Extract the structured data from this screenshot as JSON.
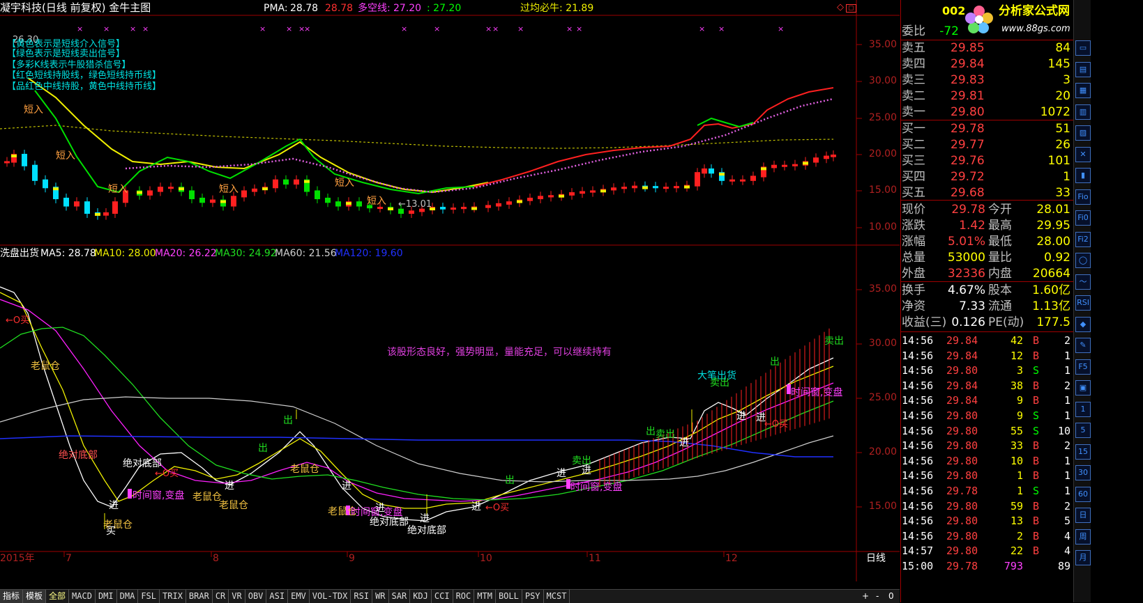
{
  "header": {
    "title": "凝宇科技(日线 前复权) 金牛主图",
    "pma_label": "PMA:",
    "pma_value1": "28.78",
    "pma_value2": "28.78",
    "dkx_label": "多空线:",
    "dkx_value1": "27.20",
    "dkx_value2": ": 27.20",
    "gjbn": "过均必牛: 21.89"
  },
  "legend": [
    "【黄色表示是短线介入信号】",
    "【绿色表示是短线卖出信号】",
    "【多彩K线表示牛股猎杀信号】",
    "【红色短线持股线，绿色短线持币线】",
    "【品红色中线持股，黄色中线持币线】"
  ],
  "price_note": "26.30",
  "low_note": "←13.01",
  "upper_signals": [
    "短入",
    "短入",
    "短入",
    "短入",
    "短入",
    "短入"
  ],
  "lower_header": {
    "name": "洗盘出货",
    "ma5": "MA5: 28.78",
    "ma10": "MA10: 28.00",
    "ma20": "MA20: 26.22",
    "ma30": "MA30: 24.92",
    "ma60": "MA60: 21.56",
    "ma120": "MA120: 19.60"
  },
  "comment": "该股形态良好，强势明显，量能充足，可以继续持有",
  "lower_signals": {
    "laoshucang": "老鼠仓",
    "juedui": "绝对底部",
    "shijianchuang": "时间窗,变盘",
    "jin": "进",
    "chu": "出",
    "maichu": "卖出",
    "dabi": "大笔出货",
    "mai": "买",
    "cmai": "←O买"
  },
  "upper_axis": [
    "35.00",
    "30.00",
    "25.00",
    "20.00",
    "15.00",
    "10.00"
  ],
  "lower_axis": [
    "35.00",
    "30.00",
    "25.00",
    "20.00",
    "15.00"
  ],
  "xaxis": [
    "2015年",
    "7",
    "8",
    "9",
    "10",
    "11",
    "12"
  ],
  "period": "日线",
  "tabs": [
    "指标",
    "模板",
    "全部",
    "MACD",
    "DMI",
    "DMA",
    "FSL",
    "TRIX",
    "BRAR",
    "CR",
    "VR",
    "OBV",
    "ASI",
    "EMV",
    "VOL-TDX",
    "RSI",
    "WR",
    "SAR",
    "KDJ",
    "CCI",
    "ROC",
    "MTM",
    "BOLL",
    "PSY",
    "MCST"
  ],
  "tab_right": [
    "+",
    "-",
    "0"
  ],
  "quote": {
    "code": "002",
    "wb_label": "委比",
    "wb_value": "-72",
    "sell": [
      {
        "label": "卖五",
        "price": "29.85",
        "vol": "84"
      },
      {
        "label": "卖四",
        "price": "29.84",
        "vol": "145"
      },
      {
        "label": "卖三",
        "price": "29.83",
        "vol": "3"
      },
      {
        "label": "卖二",
        "price": "29.81",
        "vol": "20"
      },
      {
        "label": "卖一",
        "price": "29.80",
        "vol": "1072"
      }
    ],
    "buy": [
      {
        "label": "买一",
        "price": "29.78",
        "vol": "51"
      },
      {
        "label": "买二",
        "price": "29.77",
        "vol": "26"
      },
      {
        "label": "买三",
        "price": "29.76",
        "vol": "101"
      },
      {
        "label": "买四",
        "price": "29.72",
        "vol": "1"
      },
      {
        "label": "买五",
        "price": "29.68",
        "vol": "33"
      }
    ],
    "stats": [
      {
        "l1": "现价",
        "v1": "29.78",
        "l2": "今开",
        "v2": "28.01"
      },
      {
        "l1": "涨跌",
        "v1": "1.42",
        "l2": "最高",
        "v2": "29.95"
      },
      {
        "l1": "涨幅",
        "v1": "5.01%",
        "l2": "最低",
        "v2": "28.00"
      },
      {
        "l1": "总量",
        "v1": "53000",
        "l2": "量比",
        "v2": "0.92"
      },
      {
        "l1": "外盘",
        "v1": "32336",
        "l2": "内盘",
        "v2": "20664"
      }
    ],
    "stats2": [
      {
        "l1": "换手",
        "v1": "4.67%",
        "l2": "股本",
        "v2": "1.60亿"
      },
      {
        "l1": "净资",
        "v1": "7.33",
        "l2": "流通",
        "v2": "1.13亿"
      },
      {
        "l1": "收益(三)",
        "v1": "0.126",
        "l2": "PE(动)",
        "v2": "177.5"
      }
    ],
    "ticks": [
      {
        "t": "14:56",
        "p": "29.84",
        "q": "42",
        "bs": "B",
        "c": "2"
      },
      {
        "t": "14:56",
        "p": "29.84",
        "q": "12",
        "bs": "B",
        "c": "1"
      },
      {
        "t": "14:56",
        "p": "29.80",
        "q": "3",
        "bs": "S",
        "c": "1"
      },
      {
        "t": "14:56",
        "p": "29.84",
        "q": "38",
        "bs": "B",
        "c": "2"
      },
      {
        "t": "14:56",
        "p": "29.84",
        "q": "9",
        "bs": "B",
        "c": "1"
      },
      {
        "t": "14:56",
        "p": "29.80",
        "q": "9",
        "bs": "S",
        "c": "1"
      },
      {
        "t": "14:56",
        "p": "29.80",
        "q": "55",
        "bs": "S",
        "c": "10"
      },
      {
        "t": "14:56",
        "p": "29.80",
        "q": "33",
        "bs": "B",
        "c": "2"
      },
      {
        "t": "14:56",
        "p": "29.80",
        "q": "10",
        "bs": "B",
        "c": "1"
      },
      {
        "t": "14:56",
        "p": "29.80",
        "q": "1",
        "bs": "B",
        "c": "1"
      },
      {
        "t": "14:56",
        "p": "29.78",
        "q": "1",
        "bs": "S",
        "c": "1"
      },
      {
        "t": "14:56",
        "p": "29.80",
        "q": "59",
        "bs": "B",
        "c": "2"
      },
      {
        "t": "14:56",
        "p": "29.80",
        "q": "13",
        "bs": "B",
        "c": "5"
      },
      {
        "t": "14:56",
        "p": "29.80",
        "q": "2",
        "bs": "B",
        "c": "4"
      },
      {
        "t": "14:57",
        "p": "29.80",
        "q": "22",
        "bs": "B",
        "c": "4"
      },
      {
        "t": "15:00",
        "p": "29.78",
        "q": "793",
        "bs": "",
        "c": "89"
      }
    ]
  },
  "logo": {
    "text": "分析家公式网",
    "url": "www.88gs.com"
  },
  "tools": [
    "▭",
    "▤",
    "▦",
    "▥",
    "▨",
    "✕",
    "▮",
    "Fio",
    "Fi0",
    "Fi2",
    "◯",
    "〜",
    "RSI",
    "◆",
    "✎",
    "F5",
    "▣",
    "1",
    "5",
    "15",
    "30",
    "60",
    "日",
    "周",
    "月"
  ]
}
